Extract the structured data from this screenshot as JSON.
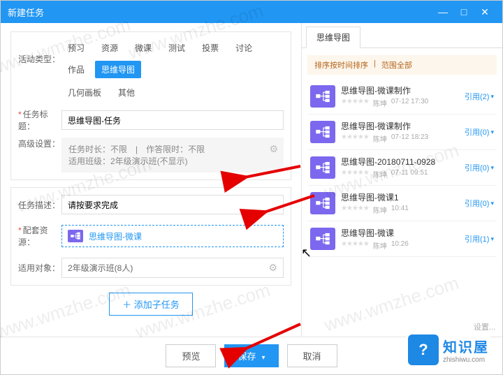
{
  "window": {
    "title": "新建任务"
  },
  "form": {
    "activity_label": "活动类型：",
    "activity_types_row1": [
      "预习",
      "资源",
      "微课",
      "测试",
      "投票",
      "讨论",
      "作品",
      "思维导图"
    ],
    "activity_types_row2": [
      "几何画板",
      "其他"
    ],
    "active_type": "思维导图",
    "title_label": "任务标题：",
    "title_value": "思维导图-任务",
    "adv_label": "高级设置：",
    "adv_line1": "任务时长：不限　|　作答限时：不限",
    "adv_line2": "适用班级：2年级演示班(不显示)",
    "desc_label": "任务描述：",
    "desc_value": "请按要求完成",
    "resource_label": "配套资源：",
    "resource_name": "思维导图-微课",
    "target_label": "适用对象：",
    "target_value": "2年级演示班(8人)",
    "add_sub": "添加子任务"
  },
  "right": {
    "tab": "思维导图",
    "filter_sort": "排序按时间排序",
    "filter_scope": "范围全部",
    "items": [
      {
        "name": "思维导图-微课制作",
        "author": "陈坤",
        "time": "07-12 17:30",
        "ref": "引用(2)"
      },
      {
        "name": "思维导图-微课制作",
        "author": "陈坤",
        "time": "07-12 18:23",
        "ref": "引用(0)"
      },
      {
        "name": "思维导图-20180711-0928",
        "author": "陈坤",
        "time": "07-11 09:51",
        "ref": "引用(0)"
      },
      {
        "name": "思维导图-微课1",
        "author": "陈坤",
        "time": "10:41",
        "ref": "引用(0)"
      },
      {
        "name": "思维导图-微课",
        "author": "陈坤",
        "time": "10:26",
        "ref": "引用(1)"
      }
    ],
    "settings": "设置..."
  },
  "footer": {
    "preview": "预览",
    "save": "保存",
    "cancel": "取消"
  },
  "branding": {
    "cn": "知识屋",
    "en": "zhishiwu.com"
  },
  "watermark": "www.wmzhe.com"
}
